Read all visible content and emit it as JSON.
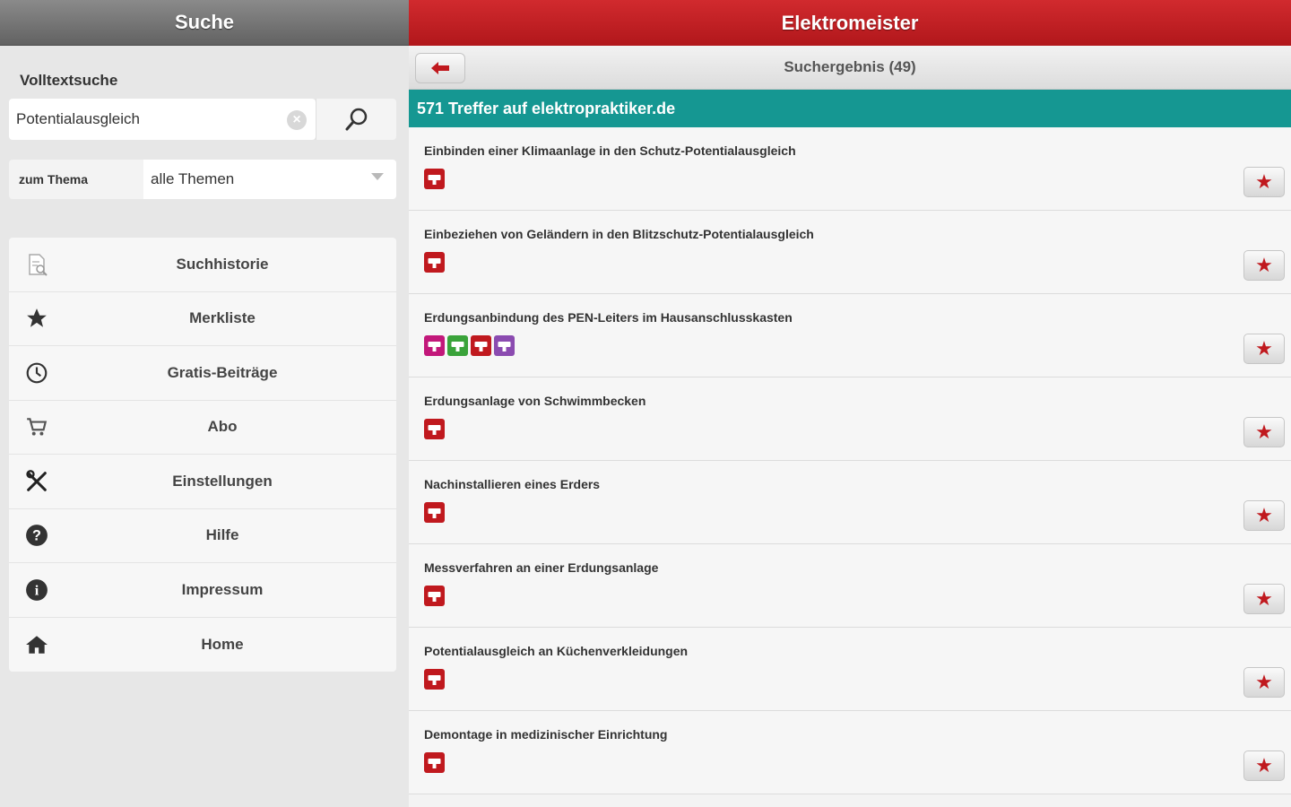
{
  "left_panel": {
    "title": "Suche",
    "search_label": "Volltextsuche",
    "search_value": "Potentialausgleich",
    "topic_label": "zum Thema",
    "topic_value": "alle Themen",
    "menu": [
      {
        "label": "Suchhistorie",
        "icon": "document-search-icon"
      },
      {
        "label": "Merkliste",
        "icon": "star-icon"
      },
      {
        "label": "Gratis-Beiträge",
        "icon": "clock-icon"
      },
      {
        "label": "Abo",
        "icon": "cart-icon"
      },
      {
        "label": "Einstellungen",
        "icon": "tools-icon"
      },
      {
        "label": "Hilfe",
        "icon": "help-icon"
      },
      {
        "label": "Impressum",
        "icon": "info-icon"
      },
      {
        "label": "Home",
        "icon": "home-icon"
      }
    ]
  },
  "right_panel": {
    "title": "Elektromeister",
    "result_title": "Suchergebnis (49)",
    "hits_text": "571 Treffer auf elektropraktiker.de",
    "results": [
      {
        "title": "Einbinden einer Klimaanlage in den Schutz-Potentialausgleich",
        "badges": [
          "red"
        ]
      },
      {
        "title": "Einbeziehen von Geländern in den Blitzschutz-Potentialausgleich",
        "badges": [
          "red"
        ]
      },
      {
        "title": "Erdungsanbindung des PEN-Leiters im Hausanschlusskasten",
        "badges": [
          "magenta",
          "green",
          "red",
          "purple"
        ]
      },
      {
        "title": "Erdungsanlage von Schwimmbecken",
        "badges": [
          "red"
        ]
      },
      {
        "title": "Nachinstallieren eines Erders",
        "badges": [
          "red"
        ]
      },
      {
        "title": "Messverfahren an einer Erdungsanlage",
        "badges": [
          "red"
        ]
      },
      {
        "title": "Potentialausgleich an Küchenverkleidungen",
        "badges": [
          "red"
        ]
      },
      {
        "title": "Demontage in medizinischer Einrichtung",
        "badges": [
          "red"
        ]
      }
    ]
  },
  "colors": {
    "header_red": "#c11d21",
    "teal": "#159792",
    "badge_red": "#c0191e",
    "badge_magenta": "#c2187a",
    "badge_green": "#3aa33a",
    "badge_purple": "#8b4bb0"
  }
}
